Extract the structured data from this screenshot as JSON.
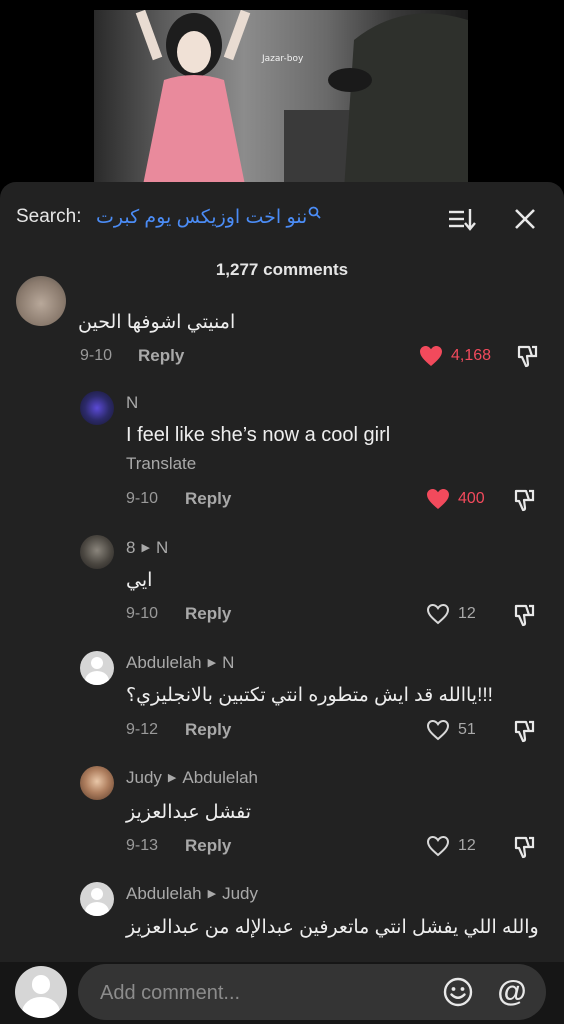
{
  "video": {
    "watermark": "Jazar-boy"
  },
  "header": {
    "search_label": "Search:",
    "search_query": "ننو اخت اوزيكس يوم كبرت",
    "comment_count": "1,277 comments"
  },
  "comments": [
    {
      "author": "",
      "text": "امنيتي اشوفها الحين",
      "translate": "",
      "date": "9-10",
      "reply": "Reply",
      "likes": "4,168",
      "liked": true
    },
    {
      "author": "N",
      "reply_to": "",
      "text": "I feel like she’s now a cool girl",
      "translate": "Translate",
      "date": "9-10",
      "reply": "Reply",
      "likes": "400",
      "liked": true
    },
    {
      "author": "8",
      "reply_to": "N",
      "text": "ايي",
      "date": "9-10",
      "reply": "Reply",
      "likes": "12",
      "liked": false
    },
    {
      "author": "Abdulelah",
      "reply_to": "N",
      "text": "ياالله قد ايش متطوره انتي تكتبين بالانجليزي؟!!!",
      "date": "9-12",
      "reply": "Reply",
      "likes": "51",
      "liked": false
    },
    {
      "author": "Judy",
      "reply_to": "Abdulelah",
      "text": "تفشل عبدالعزيز",
      "date": "9-13",
      "reply": "Reply",
      "likes": "12",
      "liked": false
    },
    {
      "author": "Abdulelah",
      "reply_to": "Judy",
      "text": "والله اللي يفشل انتي ماتعرفين عبدالإله من عبدالعزيز",
      "date": "",
      "reply": "",
      "likes": "",
      "liked": false
    }
  ],
  "composer": {
    "placeholder": "Add comment..."
  },
  "colors": {
    "panel": "#222222",
    "link": "#4b8cf5",
    "like_red": "#f24a5c"
  }
}
